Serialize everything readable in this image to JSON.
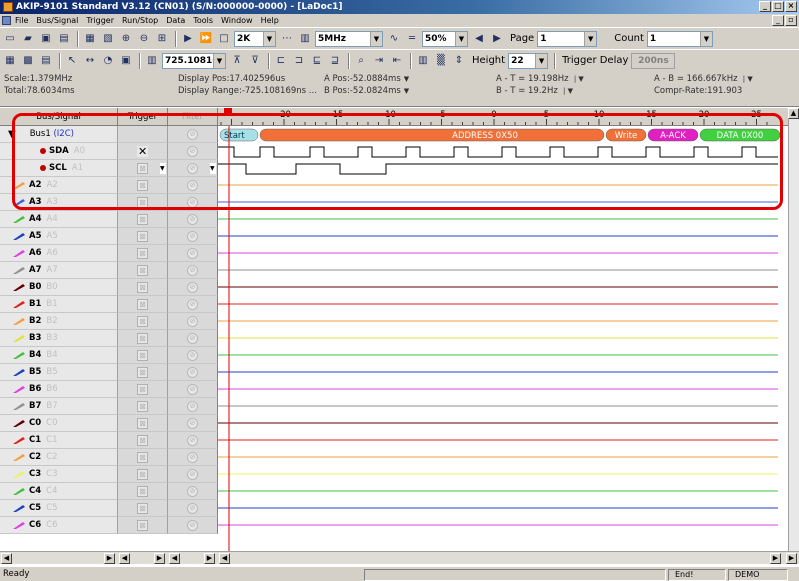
{
  "window": {
    "title": "AKIP-9101 Standard V3.12 (CN01) (S/N:000000-0000) - [LaDoc1]",
    "min": "_",
    "max": "□",
    "close": "×",
    "mdi_min": "_",
    "mdi_restore": "▫",
    "mdi_close": "×"
  },
  "menu": [
    "File",
    "Bus/Signal",
    "Trigger",
    "Run/Stop",
    "Data",
    "Tools",
    "Window",
    "Help"
  ],
  "toolbar1": {
    "sample_depth": "2K",
    "sample_rate": "5MHz",
    "trigger_pos": "50%",
    "page_label": "Page",
    "page_value": "1",
    "count_label": "Count",
    "count_value": "1"
  },
  "toolbar2": {
    "time_value": "725.10816│",
    "height_label": "Height",
    "height_value": "22",
    "trigger_delay_label": "Trigger Delay",
    "trigger_delay_value": "200ns"
  },
  "info": {
    "scale": "Scale:1.379MHz",
    "total": "Total:78.6034ms",
    "display_pos": "Display Pos:17.402596us",
    "display_range": "Display Range:-725.108169ns ...",
    "a_pos": "A Pos:-52.0884ms",
    "b_pos": "B Pos:-52.0824ms",
    "a_t": "A - T = 19.198Hz",
    "b_t": "B - T = 19.2Hz",
    "a_b": "A - B = 166.667kHz",
    "compr_rate": "Compr-Rate:191.903"
  },
  "grid_header": {
    "bus_signal": "Bus/Signal",
    "trigger": "Trigger",
    "filter": "Filter"
  },
  "ruler_ticks": [
    "-20",
    "-15",
    "-10",
    "-5",
    "0",
    "5",
    "10",
    "15",
    "20",
    "25"
  ],
  "bus": {
    "name": "Bus1",
    "type": "(I2C)",
    "arrow": "▼",
    "sda": {
      "name": "SDA",
      "sub": "A0",
      "trigger": "✕"
    },
    "scl": {
      "name": "SCL",
      "sub": "A1"
    },
    "decode": [
      "Start",
      "ADDRESS  0X50",
      "Write",
      "A-ACK",
      "DATA  0X00"
    ]
  },
  "channels": [
    {
      "name": "A2",
      "sub": "A2",
      "color": "#f0a040"
    },
    {
      "name": "A3",
      "sub": "A3",
      "color": "#4060e0"
    },
    {
      "name": "A4",
      "sub": "A4",
      "color": "#40c040"
    },
    {
      "name": "A5",
      "sub": "A5",
      "color": "#2040c0"
    },
    {
      "name": "A6",
      "sub": "A6",
      "color": "#e040e0"
    },
    {
      "name": "A7",
      "sub": "A7",
      "color": "#909090"
    },
    {
      "name": "B0",
      "sub": "B0",
      "color": "#600000"
    },
    {
      "name": "B1",
      "sub": "B1",
      "color": "#e02020"
    },
    {
      "name": "B2",
      "sub": "B2",
      "color": "#f0a040"
    },
    {
      "name": "B3",
      "sub": "B3",
      "color": "#e0e040"
    },
    {
      "name": "B4",
      "sub": "B4",
      "color": "#40c040"
    },
    {
      "name": "B5",
      "sub": "B5",
      "color": "#2040c0"
    },
    {
      "name": "B6",
      "sub": "B6",
      "color": "#e040e0"
    },
    {
      "name": "B7",
      "sub": "B7",
      "color": "#909090"
    },
    {
      "name": "C0",
      "sub": "C0",
      "color": "#600000"
    },
    {
      "name": "C1",
      "sub": "C1",
      "color": "#e02020"
    },
    {
      "name": "C2",
      "sub": "C2",
      "color": "#f0a040"
    },
    {
      "name": "C3",
      "sub": "C3",
      "color": "#f0f060"
    },
    {
      "name": "C4",
      "sub": "C4",
      "color": "#40c040"
    },
    {
      "name": "C5",
      "sub": "C5",
      "color": "#2040c0"
    },
    {
      "name": "C6",
      "sub": "C6",
      "color": "#e040e0"
    }
  ],
  "status": {
    "left": "Ready",
    "end": "End!",
    "mode": "DEMO"
  }
}
